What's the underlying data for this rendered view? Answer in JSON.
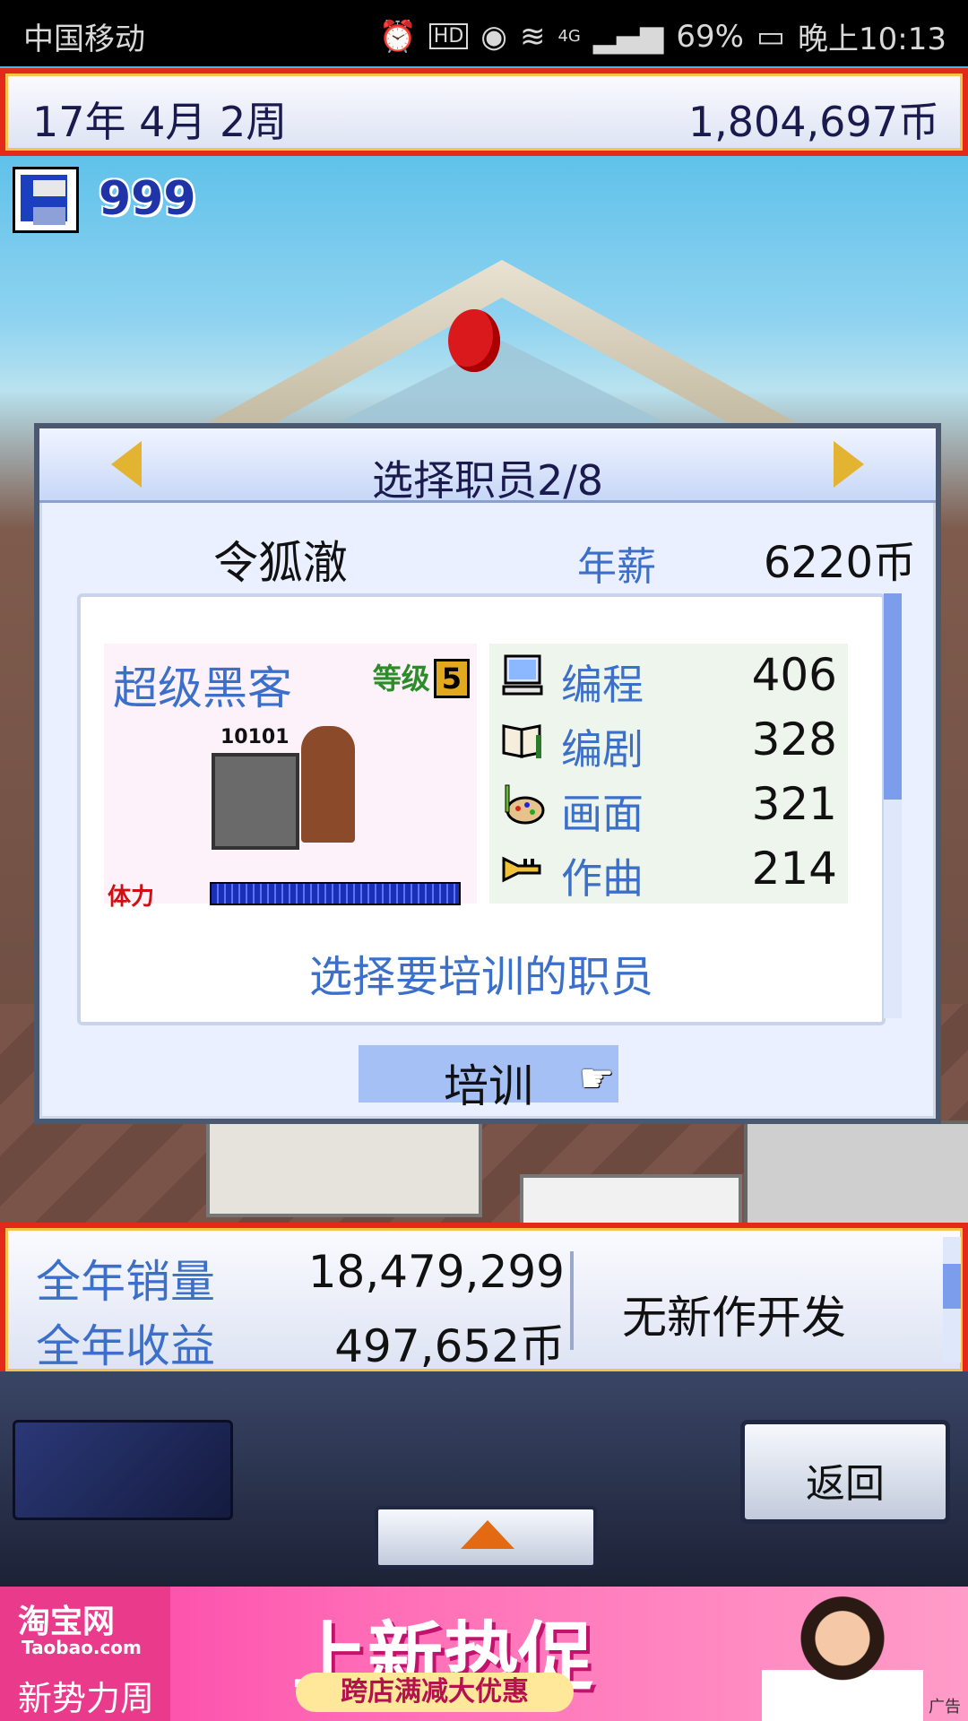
{
  "statusbar": {
    "carrier": "中国移动",
    "battery": "69%",
    "network": "4G",
    "hd": "HD",
    "time": "晚上10:13"
  },
  "topbar": {
    "date": "17年 4月 2周",
    "money": "1,804,697币"
  },
  "save": {
    "count": "999"
  },
  "dialog": {
    "title": "选择职员2/8",
    "employee_name": "令狐澈",
    "salary_label": "年薪",
    "salary": "6220币",
    "job_title": "超级黑客",
    "level_label": "等级",
    "level": "5",
    "portrait_code": "10101",
    "hp_label": "体力",
    "hp_fraction": 1.0,
    "stats": [
      {
        "name": "编程",
        "value": "406",
        "icon": "computer-icon"
      },
      {
        "name": "编剧",
        "value": "328",
        "icon": "book-icon"
      },
      {
        "name": "画面",
        "value": "321",
        "icon": "palette-icon"
      },
      {
        "name": "作曲",
        "value": "214",
        "icon": "trumpet-icon"
      }
    ],
    "prompt": "选择要培训的职员",
    "train_button": "培训"
  },
  "bottominfo": {
    "annual_sales_label": "全年销量",
    "annual_sales": "18,479,299",
    "annual_revenue_label": "全年收益",
    "annual_revenue": "497,652币",
    "status": "无新作开发"
  },
  "panel": {
    "back_button": "返回"
  },
  "ad": {
    "brand": "淘宝网",
    "brand_en": "Taobao.com",
    "brand_sub": "新势力周",
    "headline": "上新热促",
    "pill": "跨店满减大优惠",
    "tag": "广告"
  },
  "colors": {
    "accent_blue": "#3b6fc9",
    "frame_red": "#e32a1a",
    "dark_navy": "#1a1a4e"
  }
}
